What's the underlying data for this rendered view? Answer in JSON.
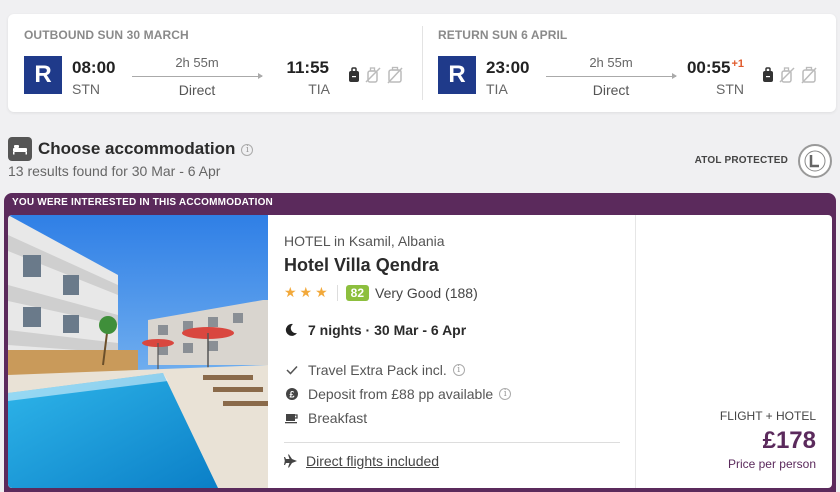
{
  "outbound": {
    "title": "OUTBOUND SUN 30 MARCH",
    "airline_logo": "R",
    "dep_time": "08:00",
    "dep_code": "STN",
    "duration": "2h 55m",
    "stops": "Direct",
    "arr_time": "11:55",
    "arr_code": "TIA",
    "arr_plus_day": ""
  },
  "return": {
    "title": "RETURN SUN 6 APRIL",
    "airline_logo": "R",
    "dep_time": "23:00",
    "dep_code": "TIA",
    "duration": "2h 55m",
    "stops": "Direct",
    "arr_time": "00:55",
    "arr_code": "STN",
    "arr_plus_day": "+1"
  },
  "accommodation": {
    "title": "Choose accommodation",
    "count": "13 results found for 30 Mar - 6 Apr",
    "atol": "ATOL PROTECTED"
  },
  "hotel": {
    "banner": "YOU WERE INTERESTED IN THIS ACCOMMODATION",
    "type_location": "HOTEL in Ksamil, Albania",
    "name": "Hotel Villa Qendra",
    "stars": "★★★",
    "score": "82",
    "score_text": "Very Good (188)",
    "nights": "7 nights · 30 Mar - 6 Apr",
    "features": [
      "Travel Extra Pack incl.",
      "Deposit from £88 pp available",
      "Breakfast"
    ],
    "flights_link": "Direct flights included",
    "price_label": "FLIGHT + HOTEL",
    "price": "£178",
    "price_sub": "Price per person"
  },
  "colors": {
    "brand_purple": "#5b2a5c",
    "airline_blue": "#1f3a8a",
    "score_green": "#8dbf3e",
    "star_orange": "#f2a93b",
    "plus_day_red": "#e05a2b"
  }
}
